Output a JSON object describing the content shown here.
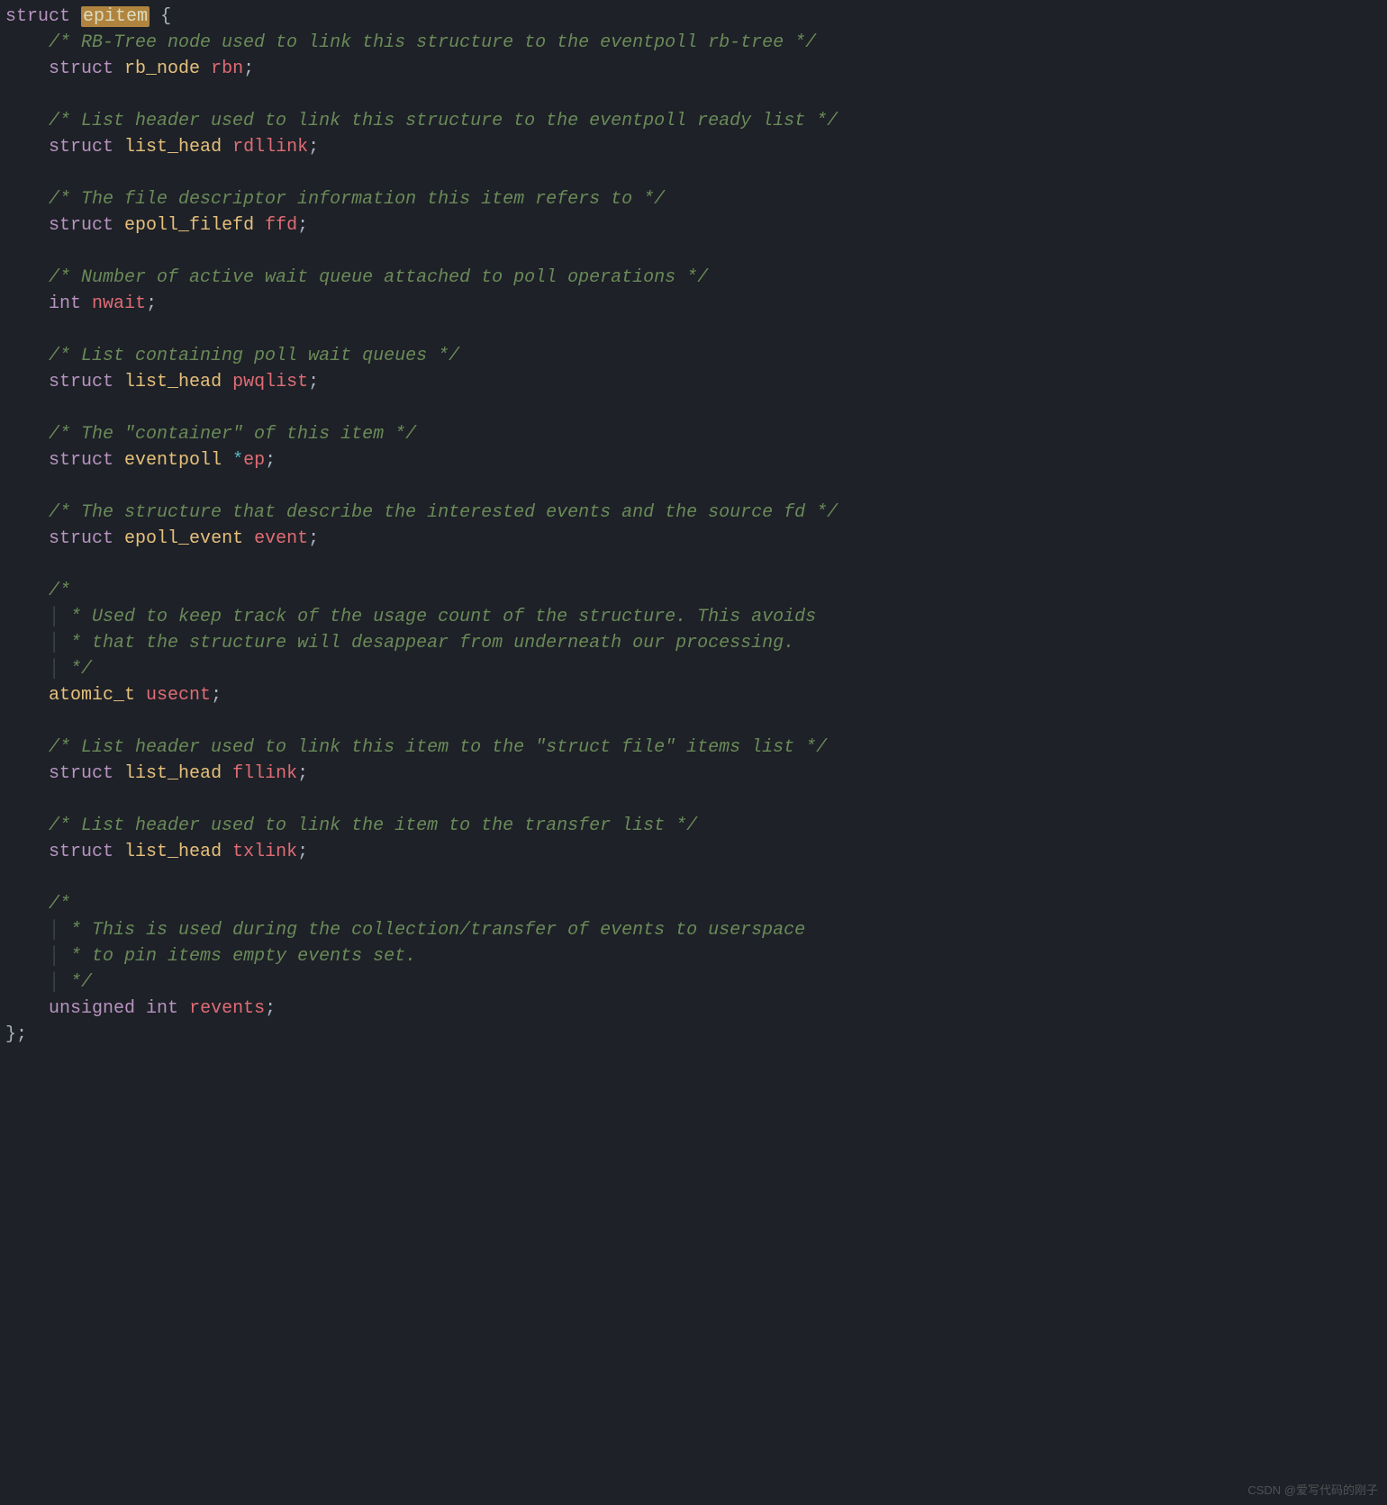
{
  "watermark": "CSDN @爱写代码的刚子",
  "code": {
    "kw_struct": "struct",
    "kw_int": "int",
    "kw_unsigned": "unsigned",
    "struct_name": "epitem",
    "brace_open": "{",
    "brace_close": "};",
    "semi": ";",
    "star": "*",
    "space": " ",
    "comments": {
      "c1": "/* RB-Tree node used to link this structure to the eventpoll rb-tree */",
      "c2": "/* List header used to link this structure to the eventpoll ready list */",
      "c3": "/* The file descriptor information this item refers to */",
      "c4": "/* Number of active wait queue attached to poll operations */",
      "c5": "/* List containing poll wait queues */",
      "c6": "/* The \"container\" of this item */",
      "c7": "/* The structure that describe the interested events and the source fd */",
      "c8a": "/*",
      "c8b": " * Used to keep track of the usage count of the structure. This avoids",
      "c8c": " * that the structure will desappear from underneath our processing.",
      "c8d": " */",
      "c9": "/* List header used to link this item to the \"struct file\" items list */",
      "c10": "/* List header used to link the item to the transfer list */",
      "c11a": "/*",
      "c11b": " * This is used during the collection/transfer of events to userspace",
      "c11c": " * to pin items empty events set.",
      "c11d": " */"
    },
    "types": {
      "rb_node": "rb_node",
      "list_head": "list_head",
      "epoll_filefd": "epoll_filefd",
      "eventpoll": "eventpoll",
      "epoll_event": "epoll_event",
      "atomic_t": "atomic_t"
    },
    "fields": {
      "rbn": "rbn",
      "rdllink": "rdllink",
      "ffd": "ffd",
      "nwait": "nwait",
      "pwqlist": "pwqlist",
      "ep": "ep",
      "event": "event",
      "usecnt": "usecnt",
      "fllink": "fllink",
      "txlink": "txlink",
      "revents": "revents"
    }
  }
}
